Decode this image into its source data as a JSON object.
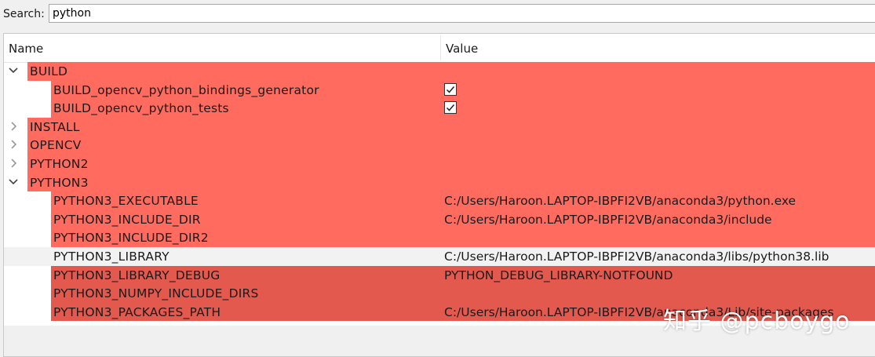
{
  "search": {
    "label": "Search:",
    "value": "python"
  },
  "columns": {
    "name": "Name",
    "value": "Value"
  },
  "rows": [
    {
      "kind": "group",
      "expanded": true,
      "name": "BUILD",
      "value": ""
    },
    {
      "kind": "child",
      "name": "BUILD_opencv_python_bindings_generator",
      "checked": true
    },
    {
      "kind": "child",
      "name": "BUILD_opencv_python_tests",
      "checked": true
    },
    {
      "kind": "group",
      "expanded": false,
      "name": "INSTALL",
      "value": ""
    },
    {
      "kind": "group",
      "expanded": false,
      "name": "OPENCV",
      "value": ""
    },
    {
      "kind": "group",
      "expanded": false,
      "name": "PYTHON2",
      "value": ""
    },
    {
      "kind": "group",
      "expanded": true,
      "name": "PYTHON3",
      "value": ""
    },
    {
      "kind": "child",
      "name": "PYTHON3_EXECUTABLE",
      "value": "C:/Users/Haroon.LAPTOP-IBPFI2VB/anaconda3/python.exe"
    },
    {
      "kind": "child",
      "name": "PYTHON3_INCLUDE_DIR",
      "value": "C:/Users/Haroon.LAPTOP-IBPFI2VB/anaconda3/include"
    },
    {
      "kind": "child",
      "name": "PYTHON3_INCLUDE_DIR2",
      "value": ""
    },
    {
      "kind": "child",
      "name": "PYTHON3_LIBRARY",
      "value": "C:/Users/Haroon.LAPTOP-IBPFI2VB/anaconda3/libs/python38.lib",
      "selected": true
    },
    {
      "kind": "child",
      "name": "PYTHON3_LIBRARY_DEBUG",
      "value": "PYTHON_DEBUG_LIBRARY-NOTFOUND"
    },
    {
      "kind": "child",
      "name": "PYTHON3_NUMPY_INCLUDE_DIRS",
      "value": ""
    },
    {
      "kind": "child",
      "name": "PYTHON3_PACKAGES_PATH",
      "value": "C:/Users/Haroon.LAPTOP-IBPFI2VB/anaconda3/Lib/site-packages"
    }
  ],
  "watermark": "知乎 @pcboygo",
  "colors": {
    "new_entry_highlight": "#ff6b5f",
    "selected_row": "#f2f2f2"
  },
  "icons": {
    "expanded": "chevron-down-icon",
    "collapsed": "chevron-right-icon",
    "checked": "checkmark-icon"
  }
}
